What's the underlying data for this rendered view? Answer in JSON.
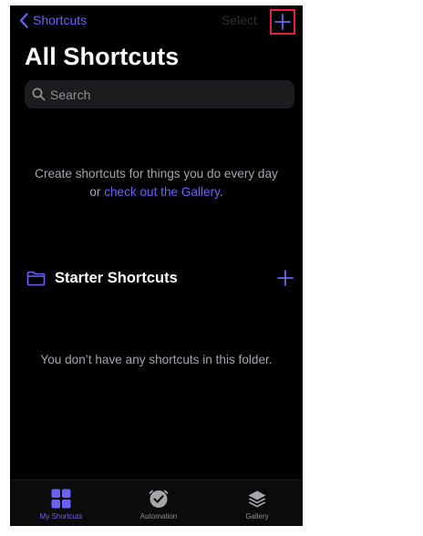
{
  "nav": {
    "back_label": "Shortcuts",
    "select_label": "Select"
  },
  "page": {
    "title": "All Shortcuts"
  },
  "search": {
    "placeholder": "Search"
  },
  "empty_state": {
    "text_before_link": "Create shortcuts for things you do every day or ",
    "link_text": "check out the Gallery",
    "text_after_link": "."
  },
  "folder": {
    "title": "Starter Shortcuts",
    "empty_message": "You don’t have any shortcuts in this folder."
  },
  "tabs": [
    {
      "label": "My Shortcuts",
      "icon": "grid-icon",
      "active": true
    },
    {
      "label": "Automation",
      "icon": "clock-check-icon",
      "active": false
    },
    {
      "label": "Gallery",
      "icon": "layers-icon",
      "active": false
    }
  ],
  "colors": {
    "accent": "#6b62f5",
    "background": "#000000",
    "search_field": "#1c1c1e",
    "secondary_text": "#a5a5aa",
    "highlight_box": "#e0213f"
  }
}
